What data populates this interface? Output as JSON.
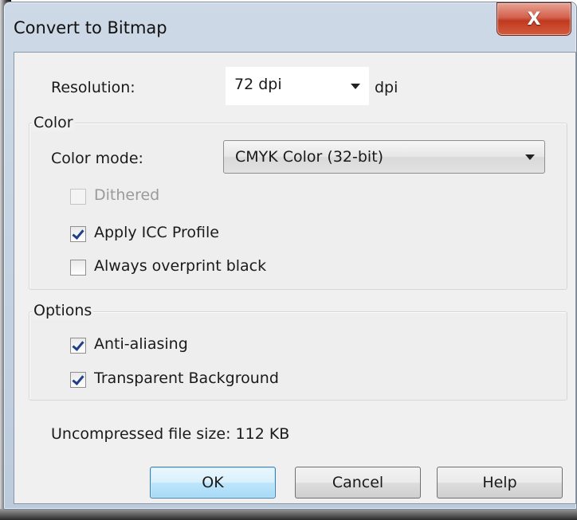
{
  "window": {
    "title": "Convert to Bitmap",
    "close_glyph": "X"
  },
  "resolution": {
    "label": "Resolution:",
    "value": "72 dpi",
    "unit": "dpi"
  },
  "color_group": {
    "title": "Color",
    "mode_label": "Color mode:",
    "mode_value": "CMYK Color (32-bit)",
    "options": [
      {
        "label": "Dithered",
        "checked": false,
        "disabled": true
      },
      {
        "label": "Apply ICC Profile",
        "checked": true,
        "disabled": false
      },
      {
        "label": "Always overprint black",
        "checked": false,
        "disabled": false
      }
    ]
  },
  "options_group": {
    "title": "Options",
    "options": [
      {
        "label": "Anti-aliasing",
        "checked": true
      },
      {
        "label": "Transparent Background",
        "checked": true
      }
    ]
  },
  "file_size": "Uncompressed file size: 112 KB",
  "buttons": {
    "ok": "OK",
    "cancel": "Cancel",
    "help": "Help"
  },
  "colors": {
    "accent": "#3c7fb1",
    "close": "#c0391f",
    "checkmark": "#1f3f8a"
  }
}
